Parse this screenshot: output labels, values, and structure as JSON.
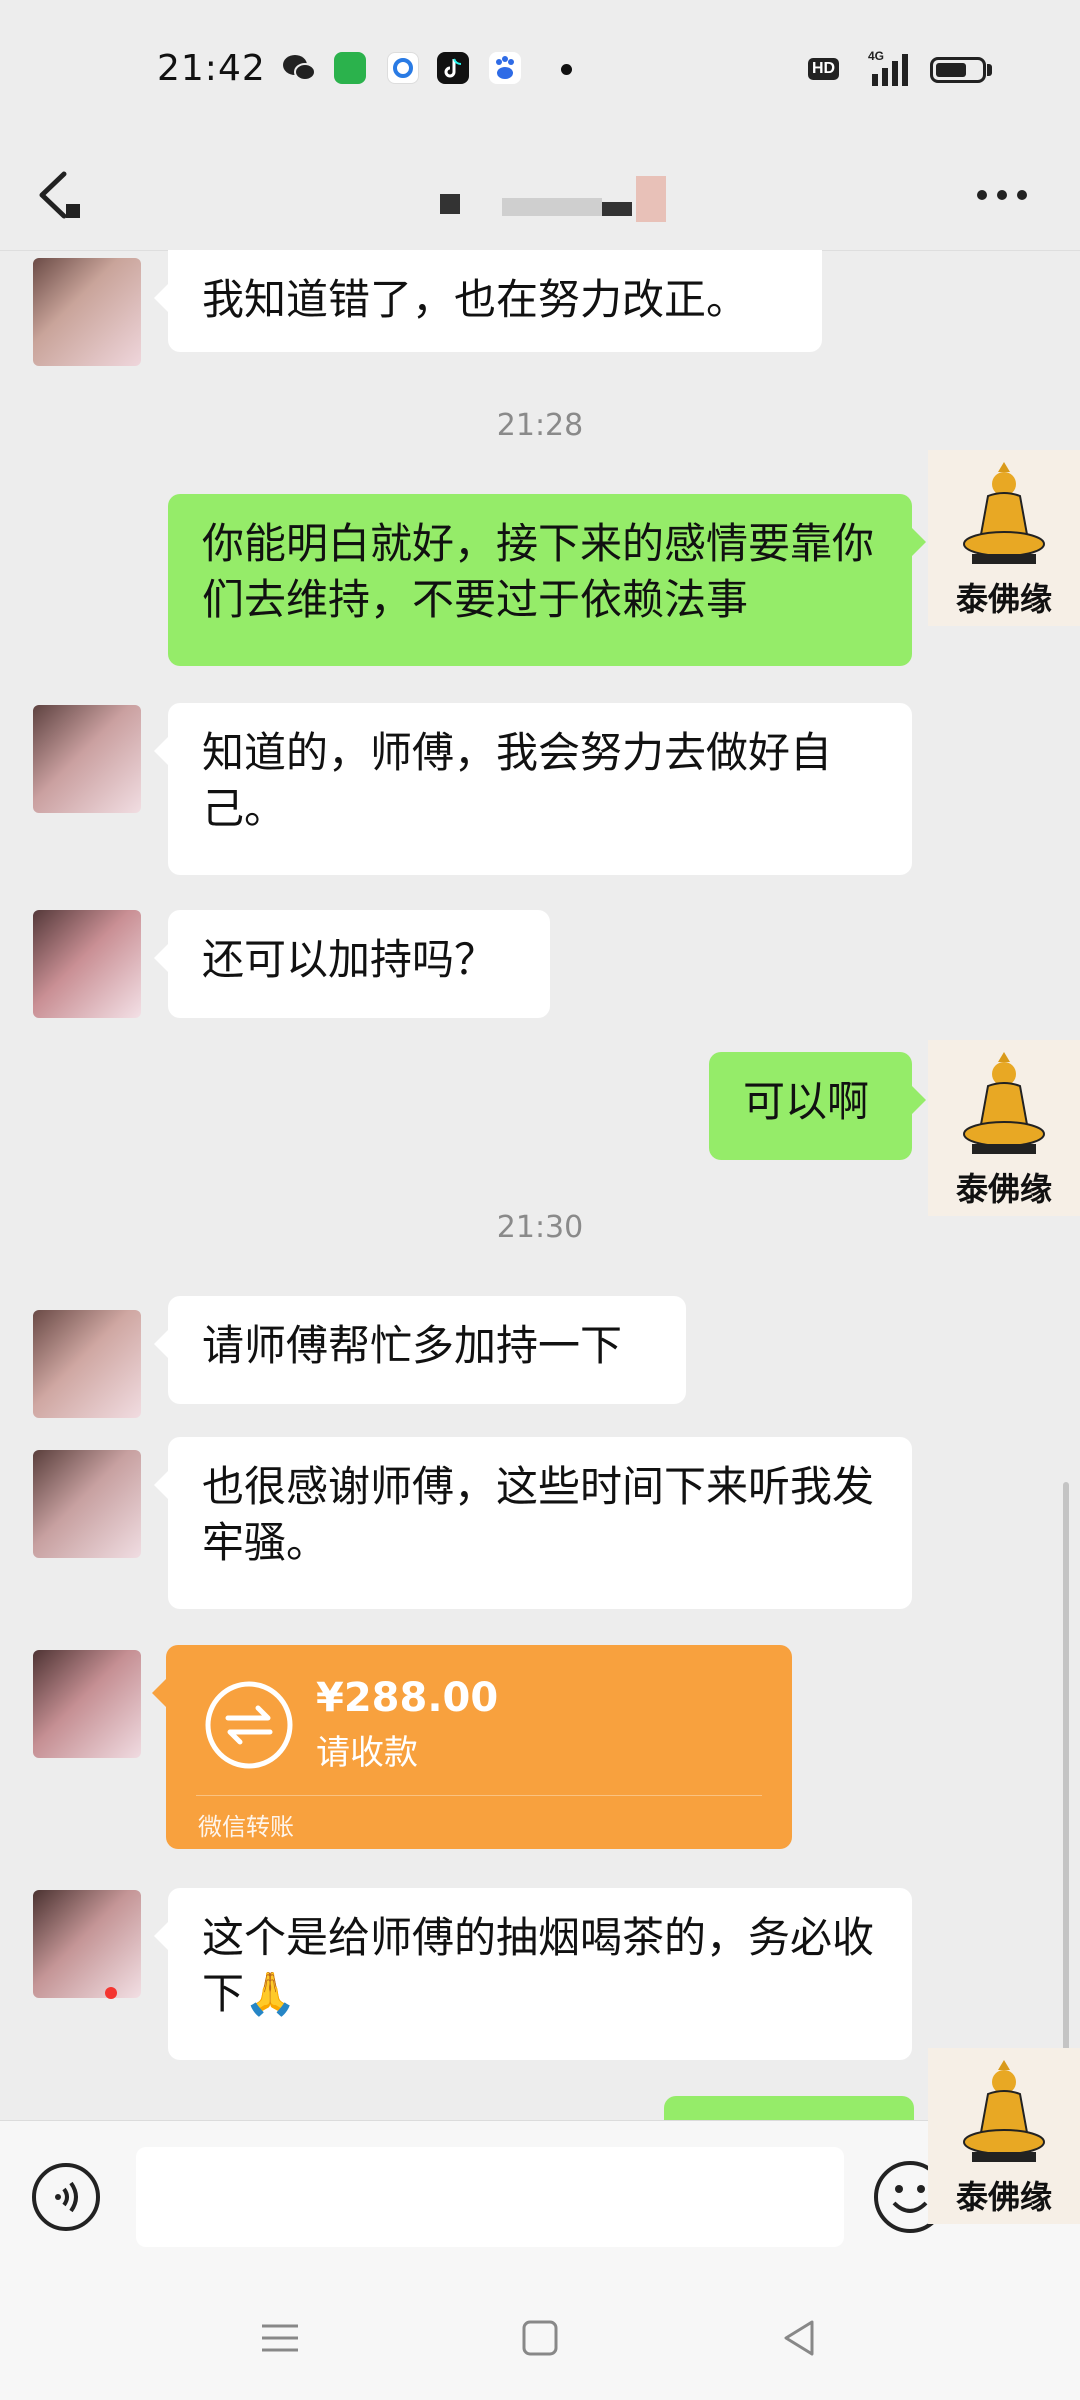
{
  "status_bar": {
    "time": "21:42",
    "hd": "HD",
    "network": "4G"
  },
  "colors": {
    "chat_bg": "#ededed",
    "outgoing_bubble": "#95ec69",
    "incoming_bubble": "#ffffff",
    "transfer_card": "#f8a13e"
  },
  "icons": {
    "back": "chevron-left-icon",
    "more": "ellipsis-icon",
    "voice": "voice-icon",
    "emoji": "emoji-icon"
  },
  "header": {
    "contact_name": ""
  },
  "messages": [
    {
      "direction": "in",
      "text": "我知道错了，也在努力改正。"
    },
    {
      "type": "time",
      "text": "21:28"
    },
    {
      "direction": "out",
      "text": "你能明白就好，接下来的感情要靠你们去维持，不要过于依赖法事"
    },
    {
      "direction": "in",
      "text": "知道的，师傅，我会努力去做好自己。"
    },
    {
      "direction": "in",
      "text": "还可以加持吗？"
    },
    {
      "direction": "out",
      "text": "可以啊"
    },
    {
      "type": "time",
      "text": "21:30"
    },
    {
      "direction": "in",
      "text": "请师傅帮忙多加持一下"
    },
    {
      "direction": "in",
      "text": "也很感谢师傅，这些时间下来听我发牢骚。"
    },
    {
      "direction": "in",
      "type": "transfer",
      "amount": "¥288.00",
      "note": "请收款",
      "footer": "微信转账"
    },
    {
      "direction": "in",
      "text": "这个是给师傅的抽烟喝茶的，务必收下🙏"
    }
  ],
  "watermark": {
    "label": "泰佛缘"
  },
  "input": {
    "placeholder": ""
  }
}
